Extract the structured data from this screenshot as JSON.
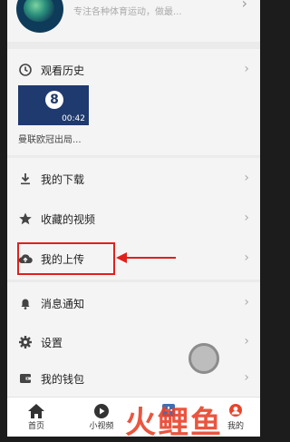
{
  "profile": {
    "description": "专注各种体育运动，做最...",
    "chevron": "›"
  },
  "history": {
    "label": "观看历史",
    "chevron": "›",
    "items": [
      {
        "badge": "8",
        "duration": "00:42",
        "title": "曼联欧冠出局..."
      }
    ]
  },
  "menu": {
    "downloads": "我的下载",
    "favorites": "收藏的视频",
    "uploads": "我的上传",
    "notifications": "消息通知",
    "settings": "设置",
    "wallet": "我的钱包",
    "chevron": "›"
  },
  "tabbar": {
    "home": "首页",
    "short_video": "小视频",
    "profile": "我的"
  },
  "watermark": "火鲤鱼",
  "colors": {
    "highlight": "#e0201c",
    "accent": "#e8432b"
  },
  "icons": {
    "history": "clock-icon",
    "downloads": "download-icon",
    "favorites": "star-icon",
    "uploads": "cloud-upload-icon",
    "notifications": "bell-icon",
    "settings": "gear-icon",
    "wallet": "wallet-icon",
    "home": "home-icon",
    "short_video": "play-icon",
    "profile": "person-icon"
  }
}
